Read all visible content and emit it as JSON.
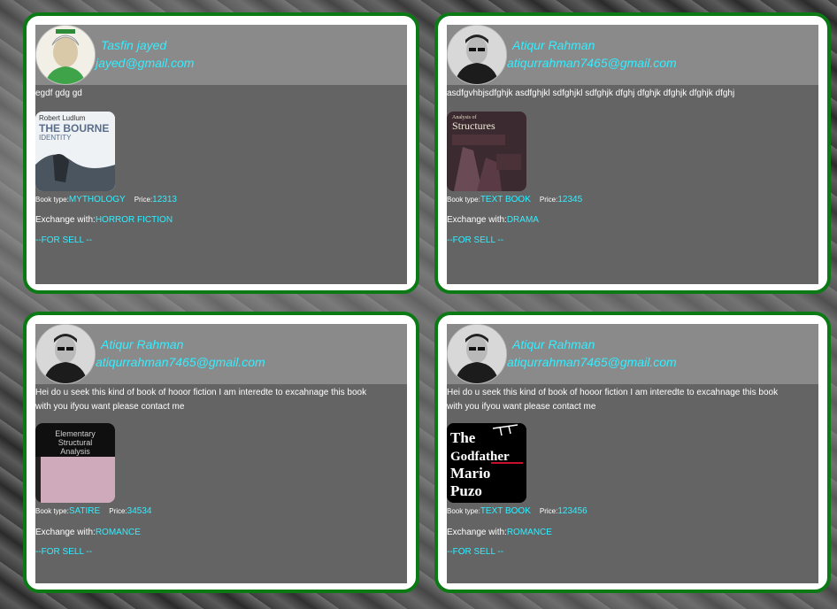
{
  "posts": [
    {
      "user_name": "Tasfin jayed",
      "email": "jayed@gmail.com",
      "description": "egdf gdg gd",
      "book_cover": {
        "line1": "Robert Ludlum",
        "line2": "THE BOURNE",
        "line3": "IDENTITY"
      },
      "book_type_label": "Book type:",
      "book_type": "MYTHOLOGY",
      "price_label": "Price:",
      "price": "12313",
      "exchange_label": "Exchange with:",
      "exchange_with": "HORROR FICTION",
      "sell_label": "--FOR SELL --"
    },
    {
      "user_name": "Atiqur Rahman",
      "email": "atiqurrahman7465@gmail.com",
      "description": "asdfgvhbjsdfghjk asdfghjkl sdfghjkl sdfghjk dfghj dfghjk dfghjk dfghjk dfghj",
      "book_cover": {
        "line1": "Analysis of",
        "line2": "Structures"
      },
      "book_type_label": "Book type:",
      "book_type": "TEXT BOOK",
      "price_label": "Price:",
      "price": "12345",
      "exchange_label": "Exchange with:",
      "exchange_with": "DRAMA",
      "sell_label": "--FOR SELL --"
    },
    {
      "user_name": "Atiqur Rahman",
      "email": "atiqurrahman7465@gmail.com",
      "description": "Hei do u seek this kind of book of hooor fiction I am interedte to excahnage this book with you ifyou want please contact me",
      "book_cover": {
        "line1": "Elementary",
        "line2": "Structural",
        "line3": "Analysis"
      },
      "book_type_label": "Book type:",
      "book_type": "SATIRE",
      "price_label": "Price:",
      "price": "34534",
      "exchange_label": "Exchange with:",
      "exchange_with": "ROMANCE",
      "sell_label": "--FOR SELL --"
    },
    {
      "user_name": "Atiqur Rahman",
      "email": "atiqurrahman7465@gmail.com",
      "description": "Hei do u seek this kind of book of hooor fiction I am interedte to excahnage this book with you ifyou want please contact me",
      "book_cover": {
        "line1": "The",
        "line2": "Godfather",
        "line3": "Mario",
        "line4": "Puzo"
      },
      "book_type_label": "Book type:",
      "book_type": "TEXT BOOK",
      "price_label": "Price:",
      "price": "123456",
      "exchange_label": "Exchange with:",
      "exchange_with": "ROMANCE",
      "sell_label": "--FOR SELL --"
    }
  ],
  "colors": {
    "card_border": "#0b7a14",
    "accent_text": "#33eeff",
    "panel_bg": "#646464",
    "header_bg": "#8a8a8a"
  }
}
